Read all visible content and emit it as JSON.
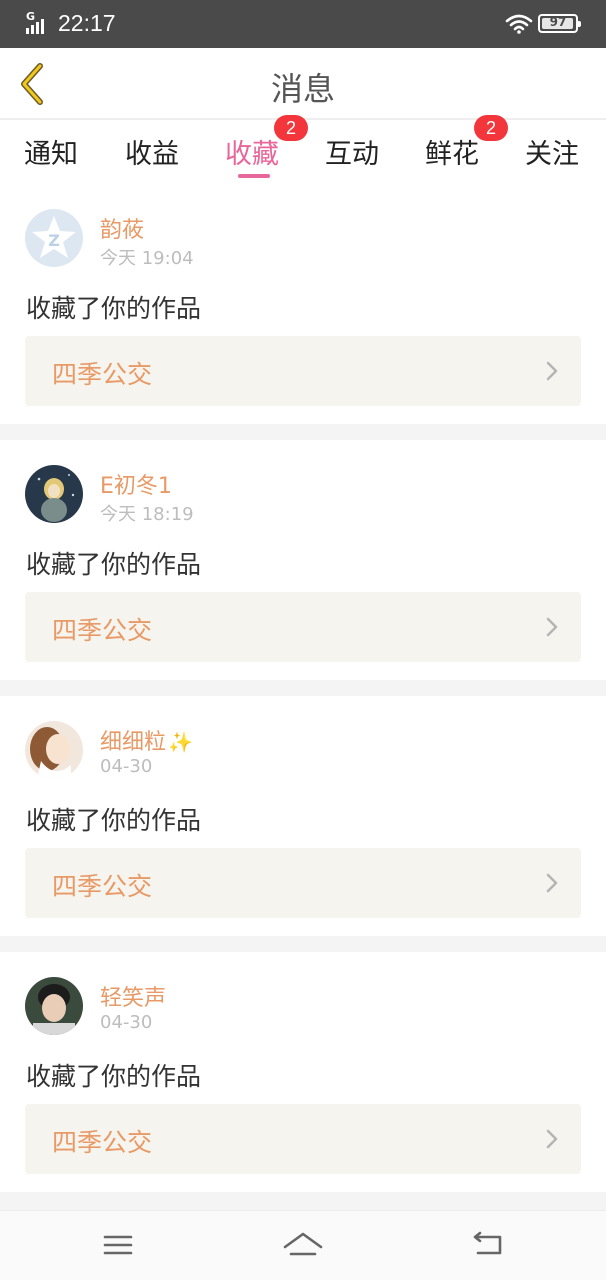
{
  "status_bar": {
    "network": "G",
    "time": "22:17",
    "battery": "97",
    "battery_level": 0.97
  },
  "header": {
    "title": "消息",
    "back_icon": "back-chevron-icon"
  },
  "tabs": [
    {
      "label": "通知",
      "badge": ""
    },
    {
      "label": "收益",
      "badge": ""
    },
    {
      "label": "收藏",
      "badge": "2",
      "active": true
    },
    {
      "label": "互动",
      "badge": ""
    },
    {
      "label": "鲜花",
      "badge": "2"
    },
    {
      "label": "关注",
      "badge": ""
    }
  ],
  "feed": [
    {
      "user": "韵莜",
      "time": "今天 19:04",
      "action": "收藏了你的作品",
      "work": "四季公交"
    },
    {
      "user": "E初冬1",
      "time": "今天 18:19",
      "action": "收藏了你的作品",
      "work": "四季公交"
    },
    {
      "user": "细细粒",
      "time": "04-30",
      "action": "收藏了你的作品",
      "work": "四季公交"
    },
    {
      "user": "轻笑声",
      "time": "04-30",
      "action": "收藏了你的作品",
      "work": "四季公交"
    }
  ],
  "colors": {
    "accent": "#e8669a",
    "name": "#e89a66",
    "badge": "#f2363b",
    "status_bar": "#4a4a4a"
  },
  "nav_icons": [
    "menu-icon",
    "home-icon",
    "back-icon"
  ]
}
